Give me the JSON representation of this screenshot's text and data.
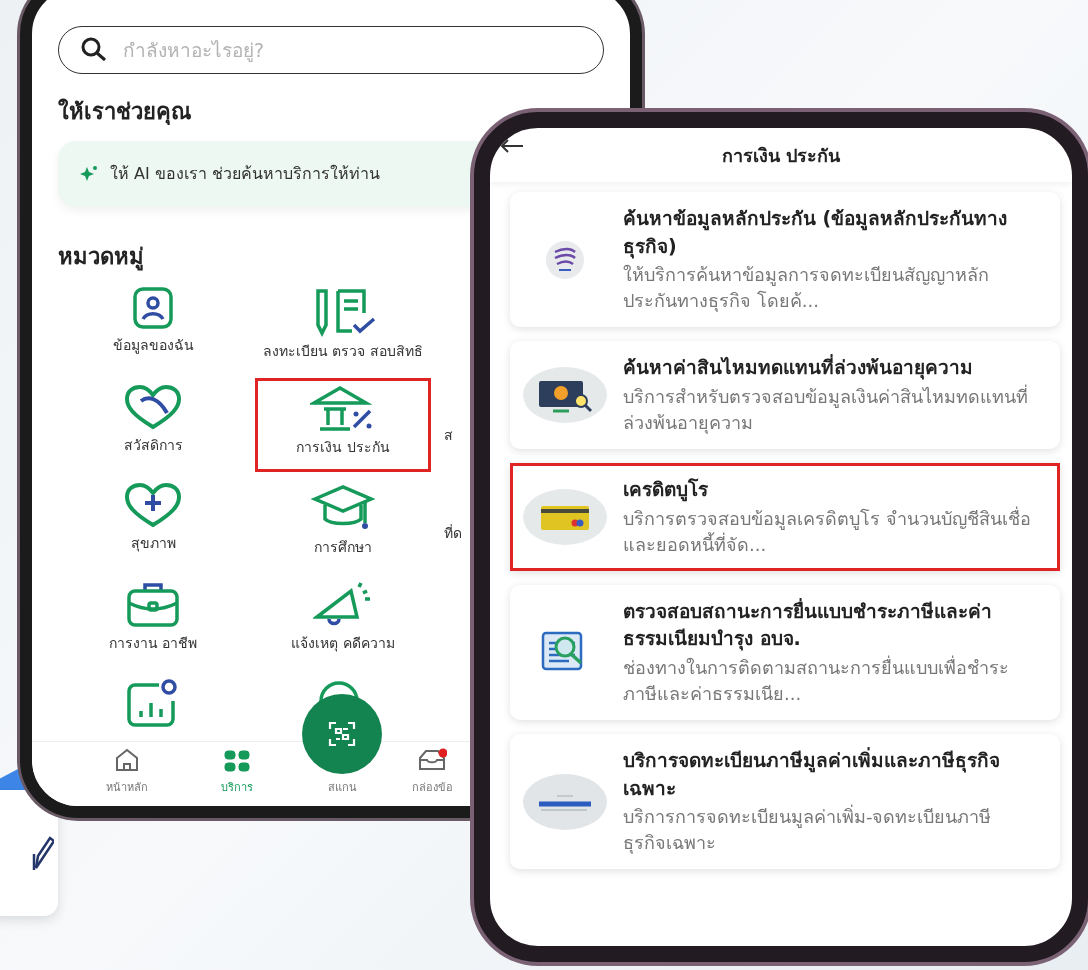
{
  "left_phone": {
    "search": {
      "placeholder": "กำลังหาอะไรอยู่?"
    },
    "help_heading": "ให้เราช่วยคุณ",
    "ai_banner": {
      "text": "ให้ AI ของเรา ช่วยค้นหาบริการให้ท่าน"
    },
    "categories_heading": "หมวดหมู่",
    "category_rows": [
      [
        {
          "kind": "person",
          "label": "ข้อมูลของฉัน",
          "selected": false
        },
        {
          "kind": "register",
          "label": "ลงทะเบียน ตรวจ สอบสิทธิ",
          "selected": false
        }
      ],
      [
        {
          "kind": "welfare",
          "label": "สวัสดิการ",
          "selected": false
        },
        {
          "kind": "finance",
          "label": "การเงิน ประกัน",
          "selected": true
        },
        {
          "kind": "partial",
          "label": "ส"
        }
      ],
      [
        {
          "kind": "health",
          "label": "สุขภาพ",
          "selected": false
        },
        {
          "kind": "education",
          "label": "การศึกษา",
          "selected": false
        },
        {
          "kind": "partial",
          "label": "ที่ด"
        }
      ],
      [
        {
          "kind": "job",
          "label": "การงาน อาชีพ",
          "selected": false
        },
        {
          "kind": "report",
          "label": "แจ้งเหตุ คดีความ",
          "selected": false
        }
      ],
      [
        {
          "kind": "stats",
          "selected": false
        },
        {
          "kind": "check",
          "selected": false
        }
      ]
    ],
    "nav": [
      {
        "kind": "home",
        "label": "หน้าหลัก",
        "selected": false
      },
      {
        "kind": "services",
        "label": "บริการ",
        "selected": true
      },
      {
        "kind": "scan",
        "label": "สแกน",
        "selected": false
      },
      {
        "kind": "inbox",
        "label": "กล่องข้อ",
        "selected": false
      }
    ]
  },
  "right_phone": {
    "title": "การเงิน ประกัน",
    "services": [
      {
        "kind": "emblem",
        "title": "ค้นหาข้อมูลหลักประกัน (ข้อมูลหลักประกันทางธุรกิจ)",
        "description": "ให้บริการค้นหาข้อมูลการจดทะเบียนสัญญาหลักประกันทางธุรกิจ โดยค้...",
        "selected": false
      },
      {
        "kind": "monitor",
        "title": "ค้นหาค่าสินไหมทดแทนที่ล่วงพ้นอายุความ",
        "description": "บริการสำหรับตรวจสอบข้อมูลเงินค่าสินไหมทดแทนที่ล่วงพ้นอายุความ",
        "selected": false
      },
      {
        "kind": "card",
        "title": "เครดิตบูโร",
        "description": "บริการตรวจสอบข้อมูลเครดิตบูโร จำนวนบัญชีสินเชื่อ และยอดหนี้ที่จัด...",
        "selected": true
      },
      {
        "kind": "document",
        "title": "ตรวจสอบสถานะการยื่นแบบชำระภาษีและค่าธรรมเนียมบำรุง อบจ.",
        "description": "ช่องทางในการติดตามสถานะการยื่นแบบเพื่อชำระภาษีและค่าธรรมเนีย...",
        "selected": false
      },
      {
        "kind": "logo",
        "title": "บริการจดทะเบียนภาษีมูลค่าเพิ่มและภาษีธุรกิจเฉพาะ",
        "description": "บริการการจดทะเบียนมูลค่าเพิ่ม-จดทะเบียนภาษีธุรกิจเฉพาะ",
        "selected": false
      }
    ]
  }
}
